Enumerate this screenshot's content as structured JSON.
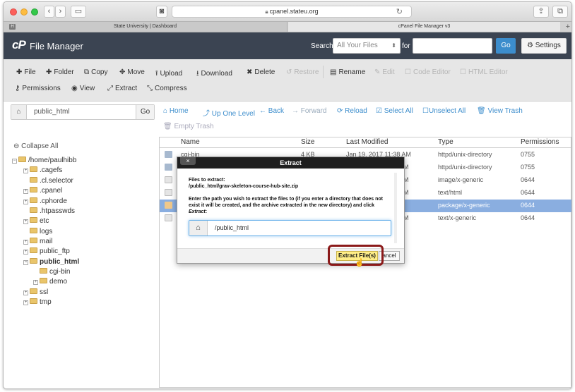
{
  "browser": {
    "url": "cpanel.stateu.org",
    "tabs": [
      {
        "label": "State University | Dashboard",
        "favicon": "H"
      },
      {
        "label": "cPanel File Manager v3"
      }
    ],
    "new_tab": "+"
  },
  "header": {
    "logo": "cP",
    "title": "File Manager",
    "search_label": "Search",
    "search_scope": "All Your Files",
    "for_label": "for",
    "search_value": "",
    "go_label": "Go",
    "settings_label": "Settings"
  },
  "toolbar": {
    "row1": [
      {
        "icon": "plus-icon",
        "label": "File",
        "enabled": true
      },
      {
        "icon": "plus-icon",
        "label": "Folder",
        "enabled": true
      },
      {
        "icon": "copy-icon",
        "label": "Copy",
        "enabled": true
      },
      {
        "icon": "move-icon",
        "label": "Move",
        "enabled": true
      },
      {
        "icon": "upload-icon",
        "label": "Upload",
        "enabled": true
      },
      {
        "icon": "download-icon",
        "label": "Download",
        "enabled": true
      },
      {
        "icon": "close-icon",
        "label": "Delete",
        "enabled": true
      },
      {
        "icon": "restore-icon",
        "label": "Restore",
        "enabled": false
      },
      {
        "icon": "file-icon",
        "label": "Rename",
        "enabled": true
      },
      {
        "icon": "pencil-icon",
        "label": "Edit",
        "enabled": false
      },
      {
        "icon": "edit-icon",
        "label": "Code Editor",
        "enabled": false
      },
      {
        "icon": "edit-icon",
        "label": "HTML Editor",
        "enabled": false
      }
    ],
    "row2": [
      {
        "icon": "key-icon",
        "label": "Permissions",
        "enabled": true
      },
      {
        "icon": "eye-icon",
        "label": "View",
        "enabled": true
      },
      {
        "icon": "expand-icon",
        "label": "Extract",
        "enabled": true
      },
      {
        "icon": "compress-icon",
        "label": "Compress",
        "enabled": true
      }
    ]
  },
  "path": {
    "value": "public_html",
    "go_label": "Go"
  },
  "nav": [
    {
      "icon": "home-icon",
      "label": "Home"
    },
    {
      "icon": "level-up-icon",
      "label": "Up One Level"
    },
    {
      "icon": "arrow-left-icon",
      "label": "Back"
    },
    {
      "icon": "arrow-right-icon",
      "label": "Forward",
      "enabled": false
    },
    {
      "icon": "reload-icon",
      "label": "Reload"
    },
    {
      "icon": "check-icon",
      "label": "Select All"
    },
    {
      "icon": "square-icon",
      "label": "Unselect All"
    },
    {
      "icon": "trash-icon",
      "label": "View Trash"
    },
    {
      "icon": "trash-icon",
      "label": "Empty Trash",
      "enabled": false
    }
  ],
  "tree": {
    "collapse_label": "Collapse All",
    "items": [
      {
        "label": "/home/paulhibb",
        "expander": "⊟"
      },
      {
        "label": ".cagefs",
        "expander": "⊞"
      },
      {
        "label": ".cl.selector",
        "expander": ""
      },
      {
        "label": ".cpanel",
        "expander": "⊞"
      },
      {
        "label": ".cphorde",
        "expander": "⊞"
      },
      {
        "label": ".htpasswds",
        "expander": ""
      },
      {
        "label": "etc",
        "expander": "⊞"
      },
      {
        "label": "logs",
        "expander": ""
      },
      {
        "label": "mail",
        "expander": "⊞"
      },
      {
        "label": "public_ftp",
        "expander": "⊞"
      },
      {
        "label": "public_html",
        "expander": "⊟",
        "bold": true
      },
      {
        "label": "cgi-bin",
        "expander": ""
      },
      {
        "label": "demo",
        "expander": "⊞"
      },
      {
        "label": "ssl",
        "expander": "⊞"
      },
      {
        "label": "tmp",
        "expander": "⊞"
      }
    ]
  },
  "filelist": {
    "columns": [
      "Name",
      "Size",
      "Last Modified",
      "Type",
      "Permissions"
    ],
    "rows": [
      {
        "name": "cgi-bin",
        "size": "4 KB",
        "modified": "Jan 19, 2017 11:38 AM",
        "type": "httpd/unix-directory",
        "perms": "0755",
        "icon": "dir",
        "selected": false
      },
      {
        "name": "",
        "size": "",
        "modified": "M",
        "type": "httpd/unix-directory",
        "perms": "0755",
        "icon": "dir",
        "selected": false
      },
      {
        "name": "",
        "size": "",
        "modified": "M",
        "type": "image/x-generic",
        "perms": "0644",
        "icon": "file",
        "selected": false
      },
      {
        "name": "",
        "size": "",
        "modified": "M",
        "type": "text/html",
        "perms": "0644",
        "icon": "file",
        "selected": false
      },
      {
        "name": "",
        "size": "",
        "modified": "",
        "type": "package/x-generic",
        "perms": "0644",
        "icon": "zip",
        "selected": true
      },
      {
        "name": "",
        "size": "",
        "modified": "M",
        "type": "text/x-generic",
        "perms": "0644",
        "icon": "file",
        "selected": false
      }
    ]
  },
  "dialog": {
    "title": "Extract",
    "close_label": "×",
    "files_label": "Files to extract:",
    "file_path": "/public_html/grav-skeleton-course-hub-site.zip",
    "instructions": "Enter the path you wish to extract the files to (if you enter a directory that does not exist it will be created, and the archive extracted in the new directory) and click",
    "instructions_em": "Extract",
    "instructions_end": ":",
    "path_value": "/public_html",
    "extract_button": "Extract File(s)",
    "cancel_button": "ancel"
  }
}
